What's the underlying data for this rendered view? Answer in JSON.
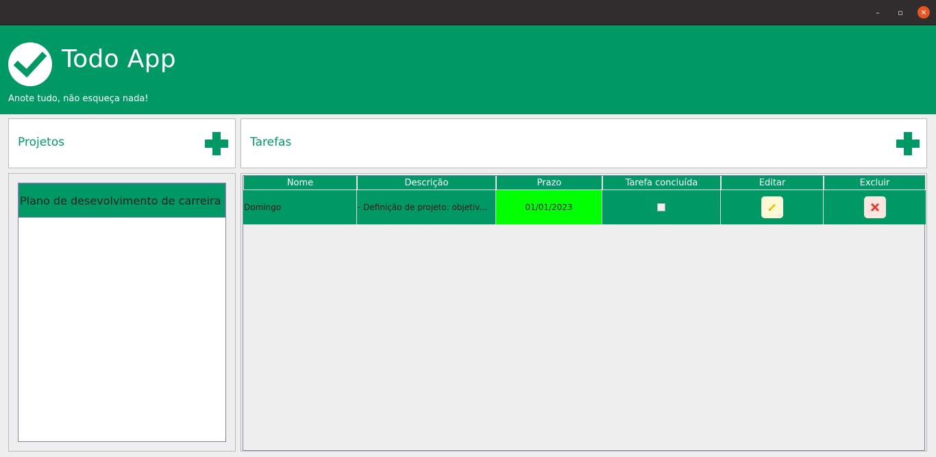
{
  "window": {
    "minimize_glyph": "–",
    "maximize_glyph": "▫",
    "close_glyph": "✕"
  },
  "header": {
    "title": "Todo App",
    "subtitle": "Anote tudo, não esqueça nada!",
    "logo_icon": "check-circle-icon"
  },
  "projects": {
    "title": "Projetos",
    "add_icon": "plus-icon",
    "items": [
      {
        "label": "Plano de desevolvimento de carreira",
        "selected": true
      }
    ]
  },
  "tasks": {
    "title": "Tarefas",
    "add_icon": "plus-icon",
    "columns": [
      "Nome",
      "Descrição",
      "Prazo",
      "Tarefa concluída",
      "Editar",
      "Excluir"
    ],
    "rows": [
      {
        "name": "Domingo",
        "description": "- Definição de projeto: objetiv...",
        "deadline": "01/01/2023",
        "completed": false,
        "edit_icon": "pencil-icon",
        "delete_icon": "close-x-icon"
      }
    ]
  },
  "colors": {
    "brand": "#009966",
    "titlebar": "#2f2d2e",
    "close_button": "#e95420",
    "deadline_highlight": "#00ff00"
  }
}
